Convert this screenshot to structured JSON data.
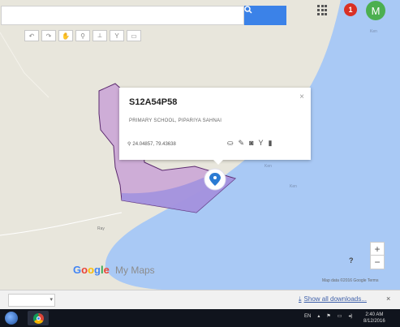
{
  "search": {
    "placeholder": ""
  },
  "toolbar": {
    "tools": [
      {
        "name": "undo-icon",
        "glyph": "↶"
      },
      {
        "name": "redo-icon",
        "glyph": "↷"
      },
      {
        "name": "hand-icon",
        "glyph": "✋"
      },
      {
        "name": "marker-icon",
        "glyph": "⚲"
      },
      {
        "name": "draw-line-icon",
        "glyph": "⟂"
      },
      {
        "name": "route-icon",
        "glyph": "Y"
      },
      {
        "name": "ruler-icon",
        "glyph": "▭"
      }
    ]
  },
  "header": {
    "notification_count": "1",
    "avatar_initial": "M"
  },
  "map": {
    "river_labels": [
      "Ken",
      "Ken",
      "Ken"
    ],
    "road_label": "Ray",
    "colors": {
      "water": "#a9c9f5",
      "land": "#e8e6dc",
      "polygon_fill": "#c9a2d6",
      "polygon_stroke": "#5b2a6f",
      "marker": "#2a7bd3"
    }
  },
  "popup": {
    "title": "S12A54P58",
    "description": "PRIMARY SCHOOL, PIPARIYA SAHNAI",
    "coords": "24.04857, 79.43638",
    "close": "×",
    "actions": [
      "style-icon",
      "edit-icon",
      "camera-icon",
      "directions-icon",
      "delete-icon"
    ]
  },
  "branding": {
    "google": "Google",
    "mymaps": "My Maps"
  },
  "controls": {
    "zoom_in": "+",
    "zoom_out": "−",
    "help": "?"
  },
  "attribution": "Map data ©2016 Google   Terms",
  "downloads": {
    "show_all": "Show all downloads...",
    "close": "×"
  },
  "taskbar": {
    "lang": "EN",
    "time": "2:40 AM",
    "date": "8/12/2016"
  }
}
